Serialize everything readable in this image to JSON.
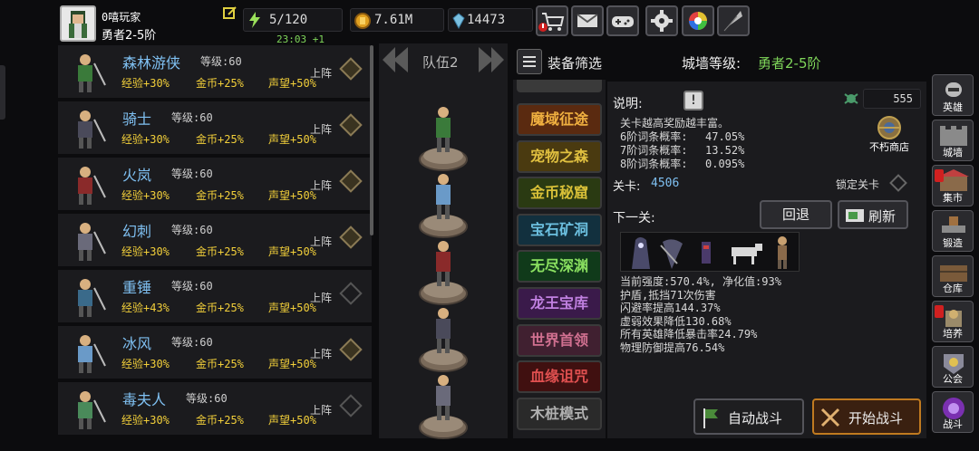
{
  "player": {
    "name": "0嘻玩家",
    "rank": "勇者2-5阶"
  },
  "resources": {
    "stamina": "5/120",
    "timer": "23:03 +1",
    "gold": "7.61M",
    "gems": "14473"
  },
  "heroes": [
    {
      "name": "森林游侠",
      "level": "等级:60",
      "exp": "经验+30%",
      "gold": "金币+25%",
      "fame": "声望+50%",
      "deploy": "上阵",
      "active": true
    },
    {
      "name": "骑士",
      "level": "等级:60",
      "exp": "经验+30%",
      "gold": "金币+25%",
      "fame": "声望+50%",
      "deploy": "上阵",
      "active": true
    },
    {
      "name": "火岚",
      "level": "等级:60",
      "exp": "经验+30%",
      "gold": "金币+25%",
      "fame": "声望+50%",
      "deploy": "上阵",
      "active": true
    },
    {
      "name": "幻刺",
      "level": "等级:60",
      "exp": "经验+30%",
      "gold": "金币+25%",
      "fame": "声望+50%",
      "deploy": "上阵",
      "active": true
    },
    {
      "name": "重锤",
      "level": "等级:60",
      "exp": "经验+43%",
      "gold": "金币+25%",
      "fame": "声望+50%",
      "deploy": "上阵",
      "active": false
    },
    {
      "name": "冰风",
      "level": "等级:60",
      "exp": "经验+30%",
      "gold": "金币+25%",
      "fame": "声望+50%",
      "deploy": "上阵",
      "active": true
    },
    {
      "name": "毒夫人",
      "level": "等级:60",
      "exp": "经验+30%",
      "gold": "金币+25%",
      "fame": "声望+50%",
      "deploy": "上阵",
      "active": false
    }
  ],
  "team": {
    "label": "队伍2"
  },
  "header": {
    "filter": "装备筛选",
    "wall_label": "城墙等级:",
    "wall_value": "勇者2-5阶"
  },
  "modes": [
    {
      "label": "魔域征途",
      "bg": "#5a2a10",
      "color": "#f0b040"
    },
    {
      "label": "宠物之森",
      "bg": "#4a3a10",
      "color": "#e0c040"
    },
    {
      "label": "金币秘窟",
      "bg": "#2a3a12",
      "color": "#d8c038"
    },
    {
      "label": "宝石矿洞",
      "bg": "#12303e",
      "color": "#6cc0e0"
    },
    {
      "label": "无尽深渊",
      "bg": "#103a1a",
      "color": "#8ae060"
    },
    {
      "label": "龙王宝库",
      "bg": "#3a1a4a",
      "color": "#c080e0"
    },
    {
      "label": "世界首领",
      "bg": "#402030",
      "color": "#d07090"
    },
    {
      "label": "血缘诅咒",
      "bg": "#401010",
      "color": "#e05050"
    },
    {
      "label": "木桩模式",
      "bg": "#2a2a2a",
      "color": "#b0b0b0"
    }
  ],
  "info": {
    "desc_label": "说明:",
    "desc": "关卡越高奖励越丰富。",
    "rate6": "6阶词条概率:",
    "rate6_val": "47.05%",
    "rate7": "7阶词条概率:",
    "rate7_val": "13.52%",
    "rate8": "8阶词条概率:",
    "rate8_val": "0.095%",
    "level_label": "关卡:",
    "level_value": "4506",
    "lock_label": "锁定关卡",
    "next_label": "下一关:",
    "back": "回退",
    "refresh": "刷新",
    "shop_count": "555",
    "shop_label": "不朽商店",
    "stats": [
      "当前强度:570.4%, 净化值:93%",
      "护盾,抵挡71次伤害",
      "闪避率提高144.37%",
      "虚弱效果降低130.68%",
      "所有英雄降低暴击率24.79%",
      "物理防御提高76.54%"
    ],
    "auto_battle": "自动战斗",
    "start_battle": "开始战斗"
  },
  "nav": [
    "英雄",
    "城墙",
    "集市",
    "锻造",
    "仓库",
    "培养",
    "公会",
    "战斗"
  ]
}
